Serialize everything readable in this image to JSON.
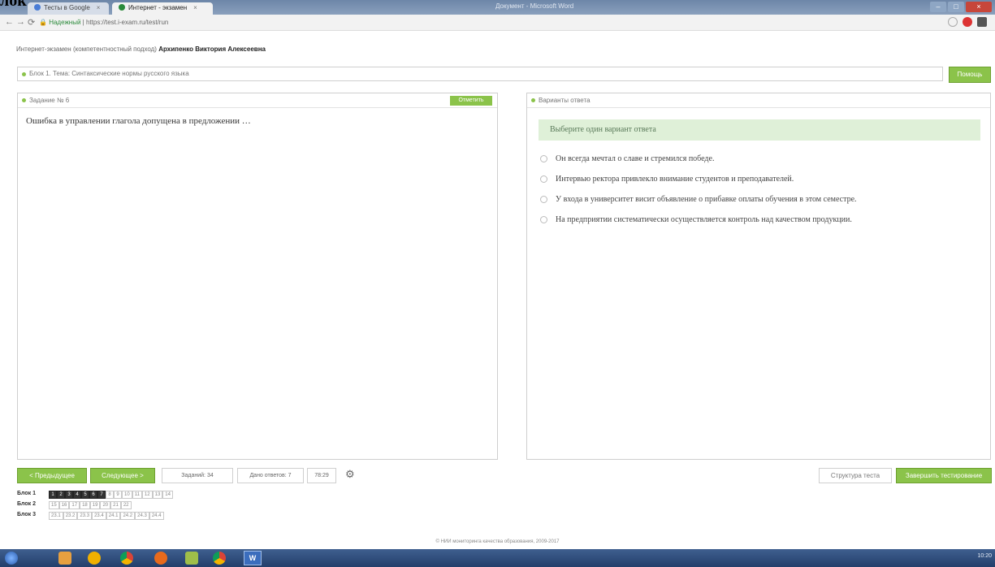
{
  "overlay_title": "лок",
  "browser": {
    "tabs": [
      {
        "label": "Тесты в Google"
      },
      {
        "label": "Интернет - экзамен"
      }
    ],
    "window_title": "Документ - Microsoft Word",
    "secure_label": "Надежный",
    "url": "https://test.i-exam.ru/test/run"
  },
  "header": {
    "prefix": "Интернет-экзамен (компетентностный подход) ",
    "user": "Архипенко Виктория Алексеевна"
  },
  "block": {
    "title": "Блок 1. Тема: Синтаксические нормы русского языка",
    "help_label": "Помощь"
  },
  "task": {
    "heading": "Задание № 6",
    "mark_label": "Отметить",
    "question": "Ошибка в управлении глагола допущена в предложении …"
  },
  "answers_panel": {
    "heading": "Варианты ответа",
    "hint": "Выберите один вариант ответа",
    "options": [
      "Он всегда мечтал о славе и стремился победе.",
      "Интервью ректора привлекло внимание студентов и преподавателей.",
      "У входа в университет висит объявление о прибавке оплаты обучения в этом семестре.",
      "На предприятии систематически осуществляется контроль над качеством продукции."
    ]
  },
  "controls": {
    "prev_label": "< Предыдущее",
    "next_label": "Следующее >",
    "tasks_label": "Заданий: 34",
    "answered_label": "Дано ответов: 7",
    "timer": "78:29",
    "structure_label": "Структура теста",
    "finish_label": "Завершить тестирование"
  },
  "blocks_nav": [
    {
      "label": "Блок 1",
      "items": [
        "1",
        "2",
        "3",
        "4",
        "5",
        "6",
        "7",
        "8",
        "9",
        "10",
        "11",
        "12",
        "13",
        "14"
      ],
      "done": 7
    },
    {
      "label": "Блок 2",
      "items": [
        "15",
        "16",
        "17",
        "18",
        "19",
        "20",
        "21",
        "22"
      ],
      "done": 0
    },
    {
      "label": "Блок 3",
      "items": [
        "23.1",
        "23.2",
        "23.3",
        "23.4",
        "24.1",
        "24.2",
        "24.3",
        "24.4"
      ],
      "done": 0
    }
  ],
  "footer": "© НИИ мониторинга качества образования, 2009-2017",
  "tray_time": "10:20"
}
